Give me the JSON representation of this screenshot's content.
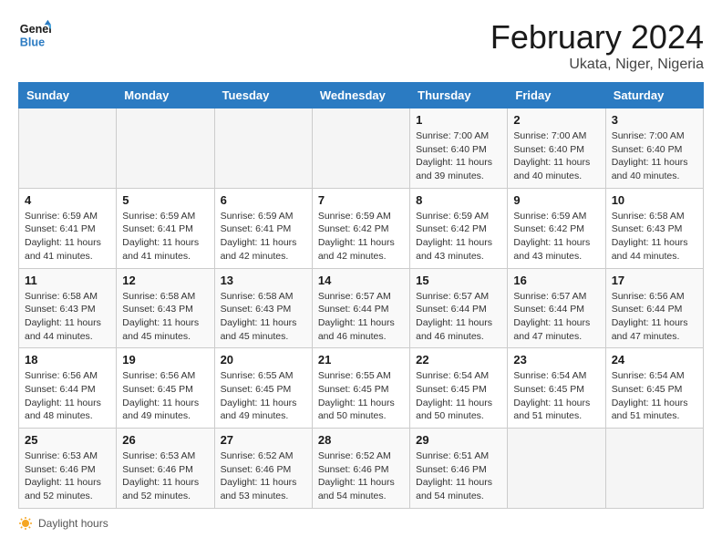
{
  "header": {
    "logo_line1": "General",
    "logo_line2": "Blue",
    "title": "February 2024",
    "subtitle": "Ukata, Niger, Nigeria"
  },
  "days_of_week": [
    "Sunday",
    "Monday",
    "Tuesday",
    "Wednesday",
    "Thursday",
    "Friday",
    "Saturday"
  ],
  "weeks": [
    [
      {
        "day": "",
        "info": ""
      },
      {
        "day": "",
        "info": ""
      },
      {
        "day": "",
        "info": ""
      },
      {
        "day": "",
        "info": ""
      },
      {
        "day": "1",
        "info": "Sunrise: 7:00 AM\nSunset: 6:40 PM\nDaylight: 11 hours\nand 39 minutes."
      },
      {
        "day": "2",
        "info": "Sunrise: 7:00 AM\nSunset: 6:40 PM\nDaylight: 11 hours\nand 40 minutes."
      },
      {
        "day": "3",
        "info": "Sunrise: 7:00 AM\nSunset: 6:40 PM\nDaylight: 11 hours\nand 40 minutes."
      }
    ],
    [
      {
        "day": "4",
        "info": "Sunrise: 6:59 AM\nSunset: 6:41 PM\nDaylight: 11 hours\nand 41 minutes."
      },
      {
        "day": "5",
        "info": "Sunrise: 6:59 AM\nSunset: 6:41 PM\nDaylight: 11 hours\nand 41 minutes."
      },
      {
        "day": "6",
        "info": "Sunrise: 6:59 AM\nSunset: 6:41 PM\nDaylight: 11 hours\nand 42 minutes."
      },
      {
        "day": "7",
        "info": "Sunrise: 6:59 AM\nSunset: 6:42 PM\nDaylight: 11 hours\nand 42 minutes."
      },
      {
        "day": "8",
        "info": "Sunrise: 6:59 AM\nSunset: 6:42 PM\nDaylight: 11 hours\nand 43 minutes."
      },
      {
        "day": "9",
        "info": "Sunrise: 6:59 AM\nSunset: 6:42 PM\nDaylight: 11 hours\nand 43 minutes."
      },
      {
        "day": "10",
        "info": "Sunrise: 6:58 AM\nSunset: 6:43 PM\nDaylight: 11 hours\nand 44 minutes."
      }
    ],
    [
      {
        "day": "11",
        "info": "Sunrise: 6:58 AM\nSunset: 6:43 PM\nDaylight: 11 hours\nand 44 minutes."
      },
      {
        "day": "12",
        "info": "Sunrise: 6:58 AM\nSunset: 6:43 PM\nDaylight: 11 hours\nand 45 minutes."
      },
      {
        "day": "13",
        "info": "Sunrise: 6:58 AM\nSunset: 6:43 PM\nDaylight: 11 hours\nand 45 minutes."
      },
      {
        "day": "14",
        "info": "Sunrise: 6:57 AM\nSunset: 6:44 PM\nDaylight: 11 hours\nand 46 minutes."
      },
      {
        "day": "15",
        "info": "Sunrise: 6:57 AM\nSunset: 6:44 PM\nDaylight: 11 hours\nand 46 minutes."
      },
      {
        "day": "16",
        "info": "Sunrise: 6:57 AM\nSunset: 6:44 PM\nDaylight: 11 hours\nand 47 minutes."
      },
      {
        "day": "17",
        "info": "Sunrise: 6:56 AM\nSunset: 6:44 PM\nDaylight: 11 hours\nand 47 minutes."
      }
    ],
    [
      {
        "day": "18",
        "info": "Sunrise: 6:56 AM\nSunset: 6:44 PM\nDaylight: 11 hours\nand 48 minutes."
      },
      {
        "day": "19",
        "info": "Sunrise: 6:56 AM\nSunset: 6:45 PM\nDaylight: 11 hours\nand 49 minutes."
      },
      {
        "day": "20",
        "info": "Sunrise: 6:55 AM\nSunset: 6:45 PM\nDaylight: 11 hours\nand 49 minutes."
      },
      {
        "day": "21",
        "info": "Sunrise: 6:55 AM\nSunset: 6:45 PM\nDaylight: 11 hours\nand 50 minutes."
      },
      {
        "day": "22",
        "info": "Sunrise: 6:54 AM\nSunset: 6:45 PM\nDaylight: 11 hours\nand 50 minutes."
      },
      {
        "day": "23",
        "info": "Sunrise: 6:54 AM\nSunset: 6:45 PM\nDaylight: 11 hours\nand 51 minutes."
      },
      {
        "day": "24",
        "info": "Sunrise: 6:54 AM\nSunset: 6:45 PM\nDaylight: 11 hours\nand 51 minutes."
      }
    ],
    [
      {
        "day": "25",
        "info": "Sunrise: 6:53 AM\nSunset: 6:46 PM\nDaylight: 11 hours\nand 52 minutes."
      },
      {
        "day": "26",
        "info": "Sunrise: 6:53 AM\nSunset: 6:46 PM\nDaylight: 11 hours\nand 52 minutes."
      },
      {
        "day": "27",
        "info": "Sunrise: 6:52 AM\nSunset: 6:46 PM\nDaylight: 11 hours\nand 53 minutes."
      },
      {
        "day": "28",
        "info": "Sunrise: 6:52 AM\nSunset: 6:46 PM\nDaylight: 11 hours\nand 54 minutes."
      },
      {
        "day": "29",
        "info": "Sunrise: 6:51 AM\nSunset: 6:46 PM\nDaylight: 11 hours\nand 54 minutes."
      },
      {
        "day": "",
        "info": ""
      },
      {
        "day": "",
        "info": ""
      }
    ]
  ],
  "footer": {
    "daylight_label": "Daylight hours"
  }
}
